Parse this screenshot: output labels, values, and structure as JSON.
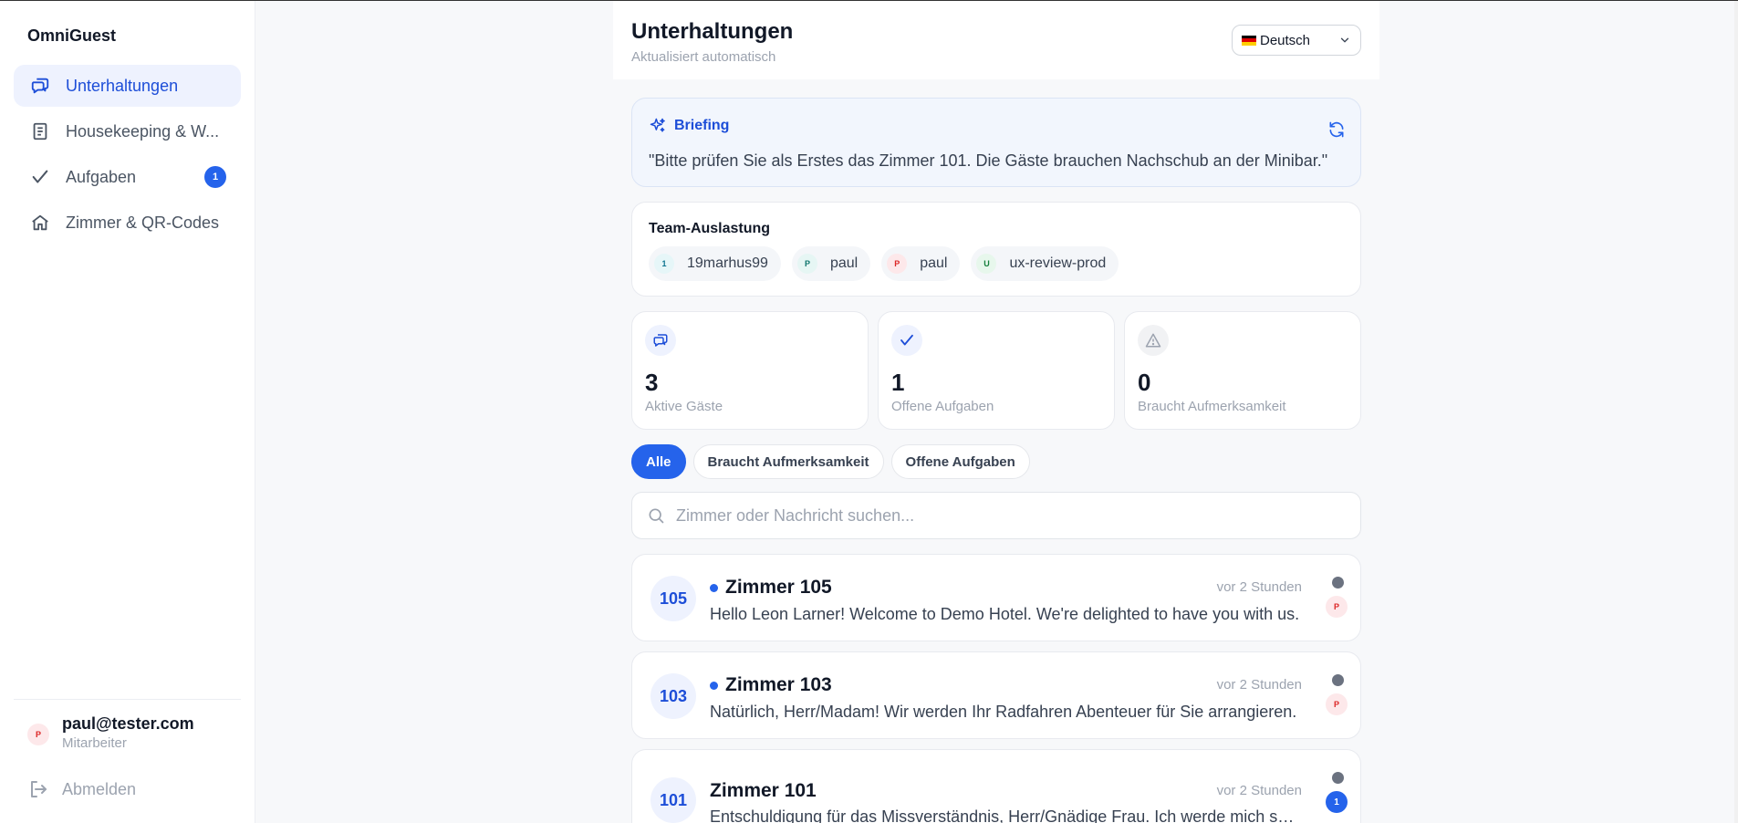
{
  "app": {
    "brand": "OmniGuest"
  },
  "sidebar": {
    "items": [
      {
        "label": "Unterhaltungen",
        "active": true,
        "icon": "chat-icon"
      },
      {
        "label": "Housekeeping & W...",
        "icon": "list-icon"
      },
      {
        "label": "Aufgaben",
        "badge": "1",
        "icon": "check-icon"
      },
      {
        "label": "Zimmer & QR-Codes",
        "icon": "home-icon"
      }
    ],
    "user": {
      "initial": "P",
      "email": "paul@tester.com",
      "role": "Mitarbeiter"
    },
    "logout_label": "Abmelden"
  },
  "header": {
    "title": "Unterhaltungen",
    "subtitle": "Aktualisiert automatisch",
    "language": "Deutsch"
  },
  "briefing": {
    "label": "Briefing",
    "text": "\"Bitte prüfen Sie als Erstes das Zimmer 101. Die Gäste brauchen Nachschub an der Minibar.\""
  },
  "team": {
    "label": "Team-Auslastung",
    "members": [
      {
        "initial": "1",
        "name": "19marhus99",
        "bg": "#e6f6f8",
        "fg": "#0e7490"
      },
      {
        "initial": "P",
        "name": "paul",
        "bg": "#e6f6f4",
        "fg": "#0f766e"
      },
      {
        "initial": "P",
        "name": "paul",
        "bg": "#fde8ea",
        "fg": "#dc2626"
      },
      {
        "initial": "U",
        "name": "ux-review-prod",
        "bg": "#e7f7ec",
        "fg": "#15803d"
      }
    ]
  },
  "stats": [
    {
      "value": "3",
      "caption": "Aktive Gäste",
      "icon": "chat-icon"
    },
    {
      "value": "1",
      "caption": "Offene Aufgaben",
      "icon": "check-icon"
    },
    {
      "value": "0",
      "caption": "Braucht Aufmerksamkeit",
      "icon": "warning-icon"
    }
  ],
  "filters": [
    {
      "label": "Alle",
      "active": true
    },
    {
      "label": "Braucht Aufmerksamkeit"
    },
    {
      "label": "Offene Aufgaben"
    }
  ],
  "search": {
    "placeholder": "Zimmer oder Nachricht suchen..."
  },
  "conversations": [
    {
      "room": "105",
      "title": "Zimmer 105",
      "unread_dot": true,
      "time": "vor 2 Stunden",
      "message": "Hello Leon Larner! Welcome to Demo Hotel. We're delighted to have you with us.",
      "assignee": "P"
    },
    {
      "room": "103",
      "title": "Zimmer 103",
      "unread_dot": true,
      "time": "vor 2 Stunden",
      "message": "Natürlich, Herr/Madam! Wir werden Ihr Radfahren Abenteuer für Sie arrangieren.",
      "assignee": "P"
    },
    {
      "room": "101",
      "title": "Zimmer 101",
      "unread_dot": false,
      "time": "vor 2 Stunden",
      "message": "Entschuldigung für das Missverständnis, Herr/Gnädige Frau. Ich werde mich sofort darum kümmern.",
      "badge": "1"
    }
  ],
  "colors": {
    "accent": "#2563eb",
    "accent_light": "#eef2fe",
    "muted": "#9ca3af"
  }
}
